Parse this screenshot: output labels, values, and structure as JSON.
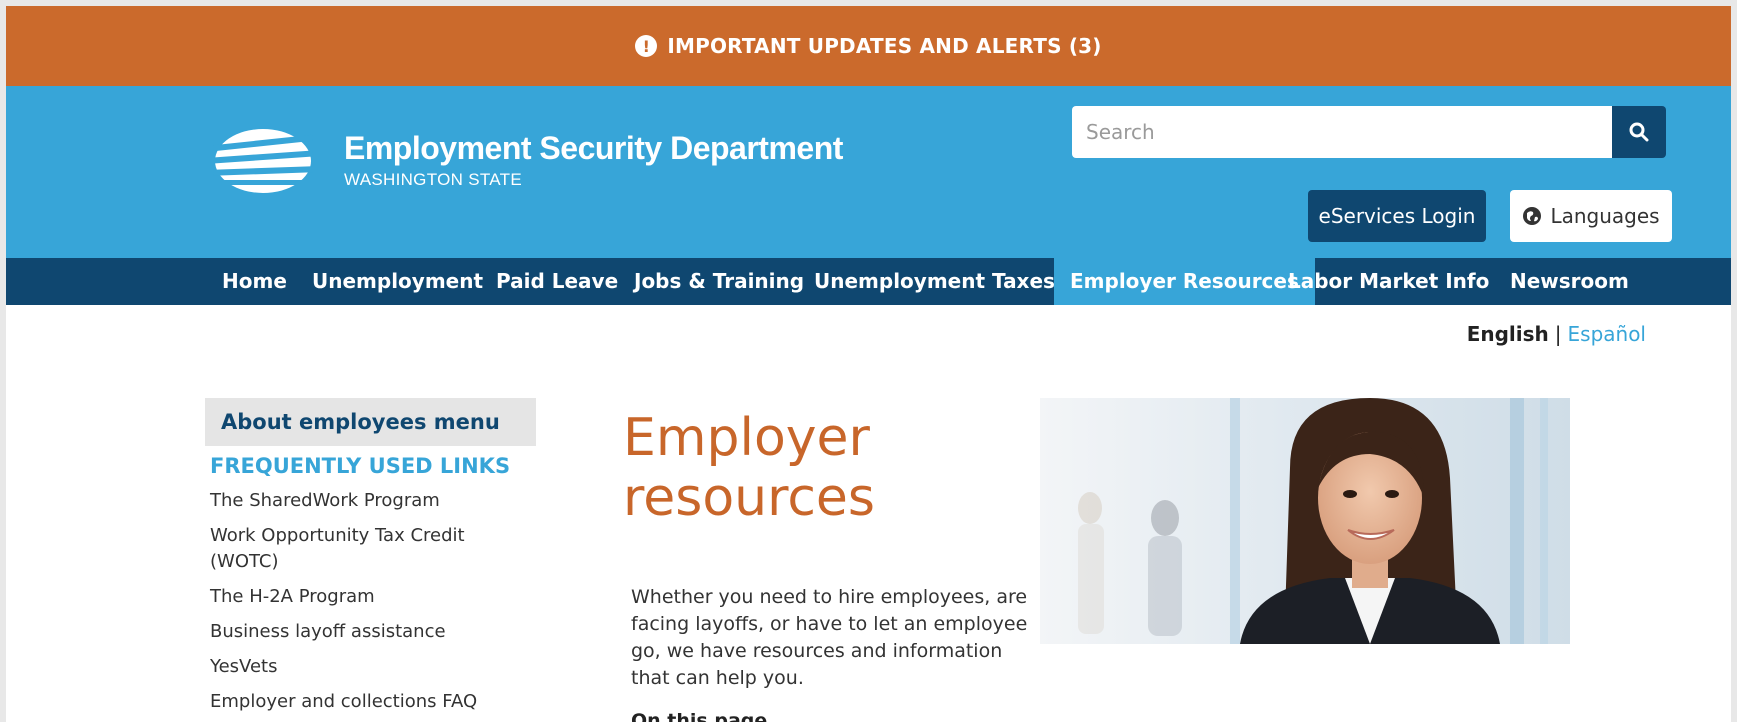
{
  "alert": {
    "text": "IMPORTANT UPDATES AND ALERTS (3)",
    "icon": "exclamation-circle-icon",
    "color": "#cb6a2c"
  },
  "header": {
    "title": "Employment Security Department",
    "subtitle": "WASHINGTON STATE",
    "color": "#37a5d8"
  },
  "search": {
    "placeholder": "Search",
    "value": "",
    "icon": "search-icon"
  },
  "buttons": {
    "eservices": "eServices Login",
    "languages": "Languages"
  },
  "nav": {
    "items": [
      {
        "label": "Home"
      },
      {
        "label": "Unemployment"
      },
      {
        "label": "Paid Leave"
      },
      {
        "label": "Jobs & Training"
      },
      {
        "label": "Unemployment Taxes"
      },
      {
        "label": "Employer Resources",
        "active": true
      },
      {
        "label": "Labor Market Info"
      },
      {
        "label": "Newsroom"
      }
    ],
    "color": "#0f4770"
  },
  "lang_switch": {
    "current": "English",
    "separator": "|",
    "other": "Español"
  },
  "sidebar": {
    "menu_title": "About employees menu",
    "section_heading": "FREQUENTLY USED LINKS",
    "links": [
      "The SharedWork Program",
      "Work Opportunity Tax Credit (WOTC)",
      "The H-2A Program",
      "Business layoff assistance",
      "YesVets",
      "Employer and collections FAQ"
    ]
  },
  "main": {
    "title": "Employer resources",
    "intro": "Whether you need to hire employees, are facing layoffs, or have to let an employee go, we have resources and information that can help you.",
    "on_this_page": "On this page"
  }
}
